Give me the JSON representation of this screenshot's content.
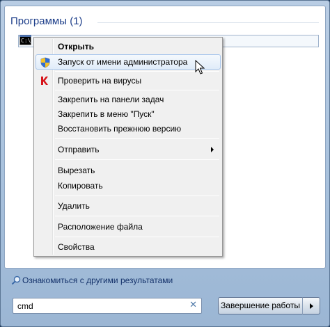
{
  "programs": {
    "title": "Программы (1)",
    "result_icon_text": "C:\\"
  },
  "menu": {
    "items": [
      {
        "label": "Открыть",
        "bold": true
      },
      {
        "label": "Запуск от имени администратора",
        "icon": "uac-shield-icon",
        "hovered": true
      },
      {
        "label": "Проверить на вирусы",
        "icon": "kaspersky-icon"
      },
      {
        "label": "Закрепить на панели задач"
      },
      {
        "label": "Закрепить в меню \"Пуск\""
      },
      {
        "label": "Восстановить прежнюю версию"
      },
      {
        "label": "Отправить",
        "submenu": true
      },
      {
        "label": "Вырезать"
      },
      {
        "label": "Копировать"
      },
      {
        "label": "Удалить"
      },
      {
        "label": "Расположение файла"
      },
      {
        "label": "Свойства"
      }
    ]
  },
  "search": {
    "more_results": "Ознакомиться с другими результатами",
    "value": "cmd",
    "clear_glyph": "✕"
  },
  "shutdown": {
    "label": "Завершение работы"
  },
  "colors": {
    "title": "#1e3f8a",
    "link": "#14326a",
    "hover_border": "#a8c6ec"
  }
}
